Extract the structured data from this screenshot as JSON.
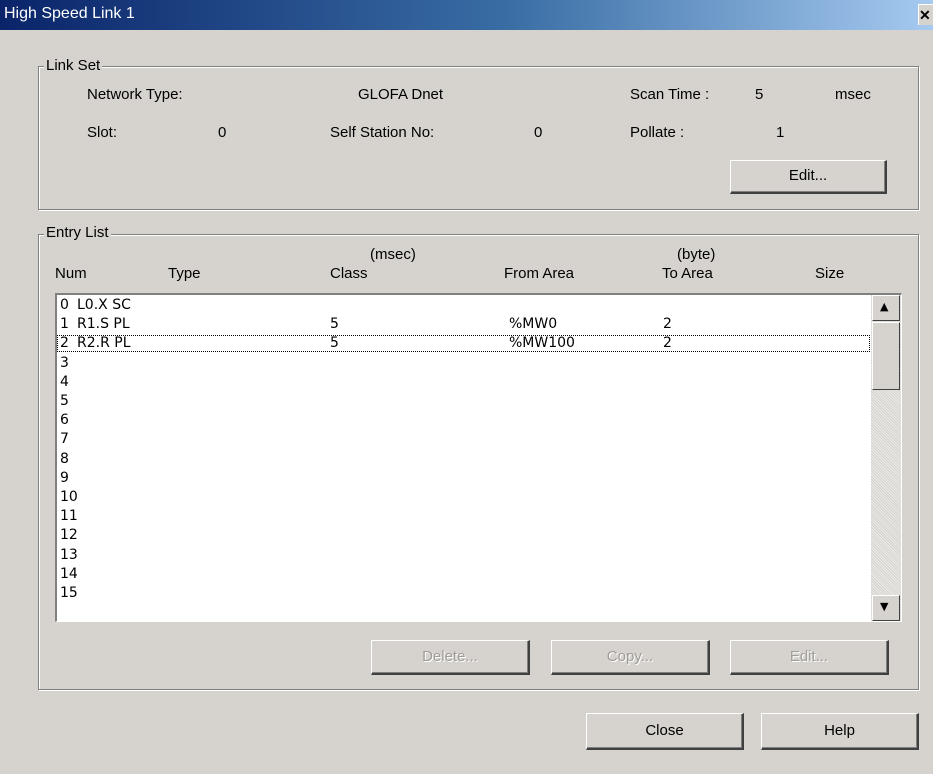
{
  "window": {
    "title": "High Speed Link 1",
    "close_glyph": "✕"
  },
  "link_set": {
    "legend": "Link Set",
    "network_type_label": "Network Type:",
    "network_type_value": "GLOFA Dnet",
    "scan_time_label": "Scan Time :",
    "scan_time_value": "5",
    "scan_time_unit": "msec",
    "slot_label": "Slot:",
    "slot_value": "0",
    "self_station_label": "Self Station No:",
    "self_station_value": "0",
    "pollate_label": "Pollate :",
    "pollate_value": "1",
    "edit_button": "Edit..."
  },
  "entry_list": {
    "legend": "Entry List",
    "unit_msec": "(msec)",
    "unit_byte": "(byte)",
    "headers": [
      "Num",
      "Type",
      "Class",
      "From Area",
      "To Area",
      "Size"
    ],
    "rows": [
      {
        "num": "0",
        "type": "L0.X SC",
        "class": "",
        "from": "",
        "to": ""
      },
      {
        "num": "1",
        "type": "R1.S PL",
        "class": "5",
        "from": "%MW0",
        "to": "2"
      },
      {
        "num": "2",
        "type": "R2.R PL",
        "class": "5",
        "from": "%MW100",
        "to": "2"
      },
      {
        "num": "3",
        "type": "",
        "class": "",
        "from": "",
        "to": ""
      },
      {
        "num": "4",
        "type": "",
        "class": "",
        "from": "",
        "to": ""
      },
      {
        "num": "5",
        "type": "",
        "class": "",
        "from": "",
        "to": ""
      },
      {
        "num": "6",
        "type": "",
        "class": "",
        "from": "",
        "to": ""
      },
      {
        "num": "7",
        "type": "",
        "class": "",
        "from": "",
        "to": ""
      },
      {
        "num": "8",
        "type": "",
        "class": "",
        "from": "",
        "to": ""
      },
      {
        "num": "9",
        "type": "",
        "class": "",
        "from": "",
        "to": ""
      },
      {
        "num": "10",
        "type": "",
        "class": "",
        "from": "",
        "to": ""
      },
      {
        "num": "11",
        "type": "",
        "class": "",
        "from": "",
        "to": ""
      },
      {
        "num": "12",
        "type": "",
        "class": "",
        "from": "",
        "to": ""
      },
      {
        "num": "13",
        "type": "",
        "class": "",
        "from": "",
        "to": ""
      },
      {
        "num": "14",
        "type": "",
        "class": "",
        "from": "",
        "to": ""
      },
      {
        "num": "15",
        "type": "",
        "class": "",
        "from": "",
        "to": ""
      }
    ],
    "selected_row": 2,
    "delete_button": "Delete...",
    "copy_button": "Copy...",
    "edit_button": "Edit..."
  },
  "footer": {
    "close_button": "Close",
    "help_button": "Help"
  },
  "icons": {
    "scroll_up": "▲",
    "scroll_down": "▼"
  }
}
